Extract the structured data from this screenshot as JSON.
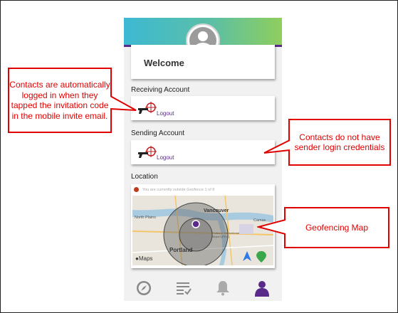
{
  "header": {
    "avatar_icon": "user-avatar-icon"
  },
  "welcome": {
    "title": "Welcome"
  },
  "receiving_account": {
    "label": "Receiving Account",
    "logout_label": "Logout",
    "icon": "crosshair-gun-icon"
  },
  "sending_account": {
    "label": "Sending Account",
    "logout_label": "Logout",
    "icon": "crosshair-gun-icon"
  },
  "location": {
    "label": "Location",
    "status_text": "You are currently outside Geofence 1 of 8",
    "status_color": "#c0391b",
    "map_labels": {
      "city1": "Vancouver",
      "city2": "Portland",
      "area1": "North Plains",
      "area2": "Camas",
      "airport": "Portland International Airport (PDX)",
      "brand": "Maps"
    }
  },
  "tabbar": {
    "items": [
      "compass-icon",
      "checklist-icon",
      "bell-icon",
      "person-icon"
    ],
    "active_color": "#5a2a8a"
  },
  "callouts": {
    "left": "Contacts are automatically logged in when they tapped the invitation code in the mobile invite email.",
    "right_top": "Contacts do not have sender login credentials",
    "right_bottom": "Geofencing Map"
  },
  "colors": {
    "callout": "#e00000",
    "accent": "#5a2a8a"
  }
}
